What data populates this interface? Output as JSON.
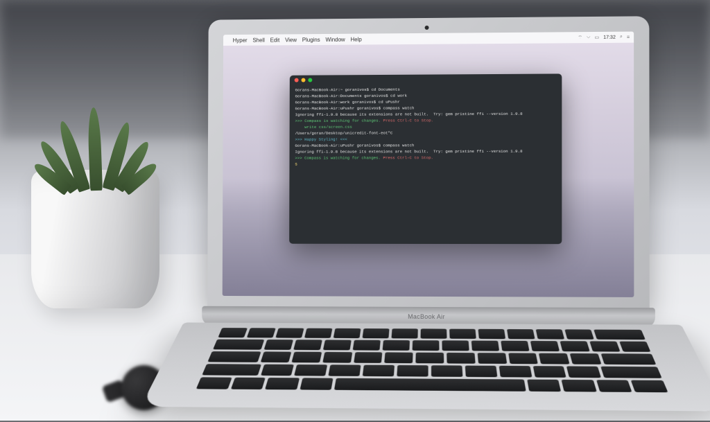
{
  "laptop_model": "MacBook Air",
  "menubar": {
    "app": "Hyper",
    "items": [
      "Shell",
      "Edit",
      "View",
      "Plugins",
      "Window",
      "Help"
    ],
    "clock": "17:32"
  },
  "terminal": {
    "traffic_lights": [
      "close",
      "minimize",
      "zoom"
    ],
    "lines": [
      {
        "segments": [
          {
            "t": "Gorans-MacBook-Air:~ goranivos$ cd Documents",
            "c": "c-white"
          }
        ]
      },
      {
        "segments": [
          {
            "t": "Gorans-MacBook-Air:Documents goranivos$ cd work",
            "c": "c-white"
          }
        ]
      },
      {
        "segments": [
          {
            "t": "Gorans-MacBook-Air:work goranivos$ cd uPushr",
            "c": "c-white"
          }
        ]
      },
      {
        "segments": [
          {
            "t": "Gorans-MacBook-Air:uPushr goranivos$ compass watch",
            "c": "c-white"
          }
        ]
      },
      {
        "segments": [
          {
            "t": "Ignoring ffi-1.9.8 because its extensions are not built.  Try: gem pristine ffi --version 1.9.8",
            "c": "c-white"
          }
        ]
      },
      {
        "segments": [
          {
            "t": ">>> Compass is watching for changes. ",
            "c": "c-green"
          },
          {
            "t": "Press Ctrl-C to Stop.",
            "c": "c-red"
          }
        ]
      },
      {
        "segments": [
          {
            "t": "    write css/screen.css",
            "c": "c-green"
          }
        ]
      },
      {
        "segments": [
          {
            "t": "/Users/goran/Desktop/unicredit-font-eot\"C",
            "c": "c-white"
          }
        ]
      },
      {
        "segments": [
          {
            "t": ">>> ",
            "c": "c-cyan"
          },
          {
            "t": "Happy Styling!",
            "c": "c-cyan"
          },
          {
            "t": " <<<",
            "c": "c-cyan"
          }
        ]
      },
      {
        "segments": [
          {
            "t": "Gorans-MacBook-Air:uPushr goranivos$ compass watch",
            "c": "c-white"
          }
        ]
      },
      {
        "segments": [
          {
            "t": "Ignoring ffi-1.9.8 because its extensions are not built.  Try: gem pristine ffi --version 1.9.8",
            "c": "c-white"
          }
        ]
      },
      {
        "segments": [
          {
            "t": ">>> Compass is watching for changes. ",
            "c": "c-green"
          },
          {
            "t": "Press Ctrl-C to Stop.",
            "c": "c-red"
          }
        ]
      },
      {
        "segments": [
          {
            "t": "$ ",
            "c": "c-yellow"
          }
        ]
      }
    ]
  }
}
